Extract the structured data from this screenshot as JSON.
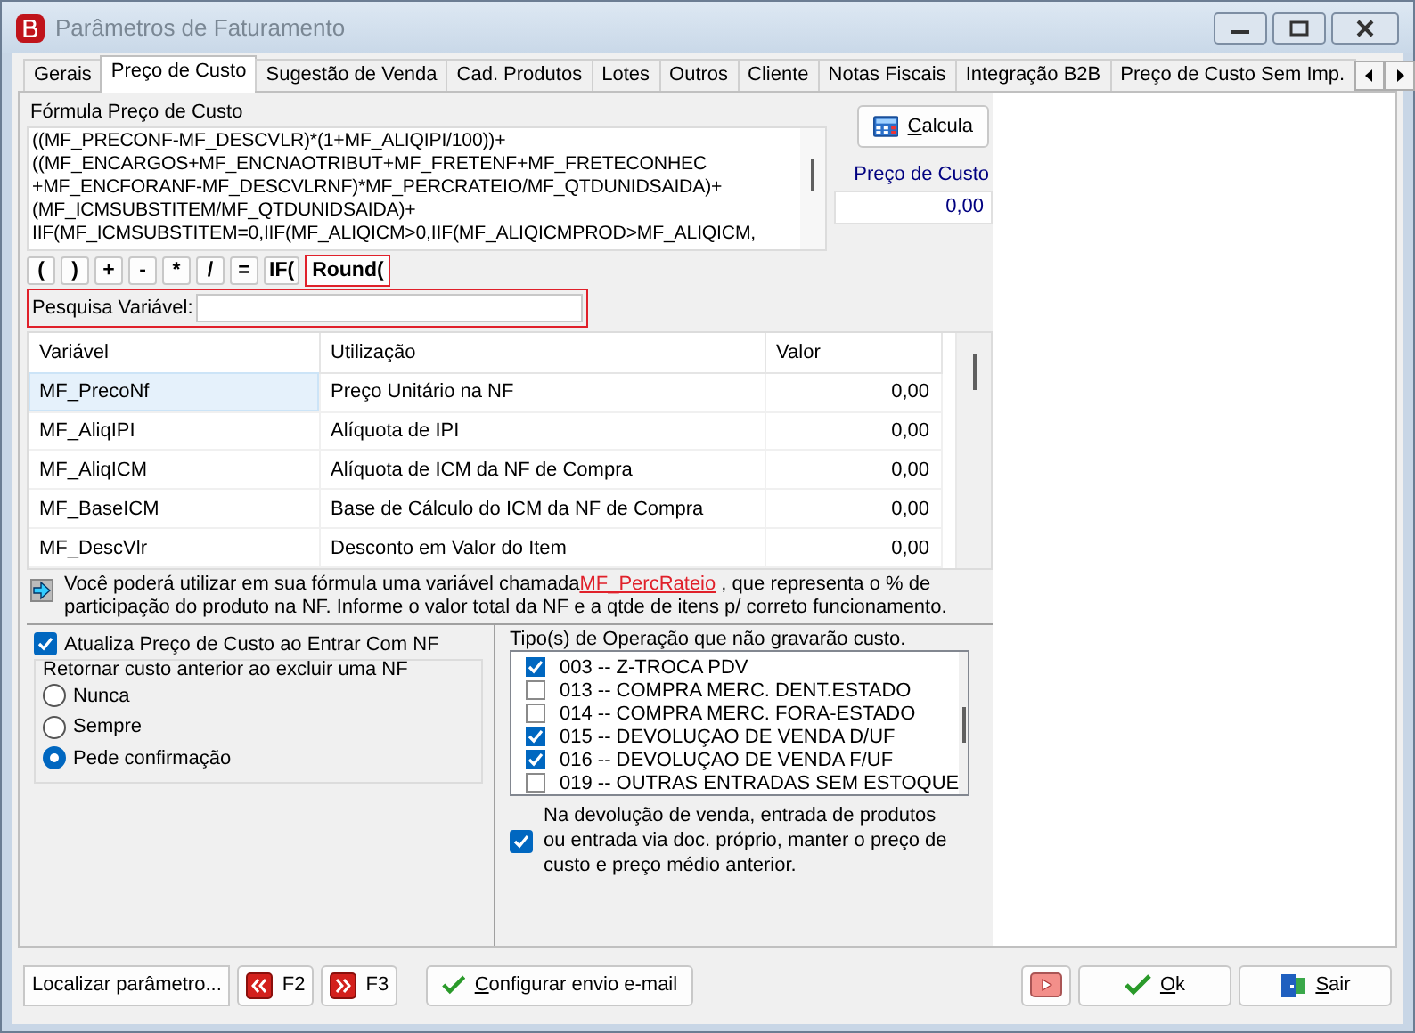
{
  "window": {
    "title": "Parâmetros de Faturamento"
  },
  "tabs": [
    {
      "label": "Gerais",
      "selected": false
    },
    {
      "label": "Preço de Custo",
      "selected": true
    },
    {
      "label": "Sugestão de  Venda",
      "selected": false
    },
    {
      "label": "Cad. Produtos",
      "selected": false
    },
    {
      "label": "Lotes",
      "selected": false
    },
    {
      "label": "Outros",
      "selected": false
    },
    {
      "label": "Cliente",
      "selected": false
    },
    {
      "label": "Notas Fiscais",
      "selected": false
    },
    {
      "label": "Integração B2B",
      "selected": false
    },
    {
      "label": "Preço de Custo Sem Imp.",
      "selected": false
    }
  ],
  "formula": {
    "label": "Fórmula Preço de Custo",
    "lines": [
      "((MF_PRECONF-MF_DESCVLR)*(1+MF_ALIQIPI/100))+",
      "((MF_ENCARGOS+MF_ENCNAOTRIBUT+MF_FRETENF+MF_FRETECONHEC",
      "+MF_ENCFORANF-MF_DESCVLRNF)*MF_PERCRATEIO/MF_QTDUNIDSAIDA)+",
      "(MF_ICMSUBSTITEM/MF_QTDUNIDSAIDA)+",
      "IIF(MF_ICMSUBSTITEM=0,IIF(MF_ALIQICM>0,IIF(MF_ALIQICMPROD>MF_ALIQICM,"
    ]
  },
  "calc_button": "Calcula",
  "cost": {
    "label": "Preço de Custo",
    "value": "0,00"
  },
  "operators": [
    {
      "label": "(",
      "highlighted": false
    },
    {
      "label": ")",
      "highlighted": false
    },
    {
      "label": "+",
      "highlighted": false
    },
    {
      "label": "-",
      "highlighted": false
    },
    {
      "label": "*",
      "highlighted": false
    },
    {
      "label": "/",
      "highlighted": false
    },
    {
      "label": "=",
      "highlighted": false
    },
    {
      "label": "IF(",
      "highlighted": false
    },
    {
      "label": "Round(",
      "highlighted": true
    }
  ],
  "search": {
    "label": "Pesquisa Variável:",
    "highlighted": true
  },
  "table": {
    "columns": [
      "Variável",
      "Utilização",
      "Valor"
    ],
    "rows": [
      {
        "cells": [
          "MF_PrecoNf",
          "Preço Unitário na NF",
          "0,00"
        ],
        "selected": true
      },
      {
        "cells": [
          "MF_AliqIPI",
          "Alíquota de IPI",
          "0,00"
        ],
        "selected": false
      },
      {
        "cells": [
          "MF_AliqICM",
          "Alíquota de ICM da NF de Compra",
          "0,00"
        ],
        "selected": false
      },
      {
        "cells": [
          "MF_BaseICM",
          "Base de Cálculo do ICM da NF de Compra",
          "0,00"
        ],
        "selected": false
      },
      {
        "cells": [
          "MF_DescVlr",
          "Desconto em Valor do Item",
          "0,00"
        ],
        "selected": false
      }
    ]
  },
  "note": {
    "before": "Você poderá utilizar em sua fórmula uma variável chamada",
    "link": "MF_PercRateio",
    "after": " , que representa o % de participação do produto na NF. Informe o valor total da NF e a qtde de itens p/ correto funcionamento."
  },
  "update_cost": {
    "label": "Atualiza Preço de Custo ao Entrar Com NF",
    "checked": true
  },
  "return_cost": {
    "label": "Retornar custo anterior ao excluir uma NF",
    "options": [
      {
        "label": "Nunca",
        "selected": false
      },
      {
        "label": "Sempre",
        "selected": false
      },
      {
        "label": "Pede confirmação",
        "selected": true
      }
    ]
  },
  "operations": {
    "label": "Tipo(s) de Operação que não gravarão custo.",
    "items": [
      {
        "label": "003 -- Z-TROCA PDV",
        "checked": true
      },
      {
        "label": "013 -- COMPRA MERC. DENT.ESTADO",
        "checked": false
      },
      {
        "label": "014 -- COMPRA MERC. FORA-ESTADO",
        "checked": false
      },
      {
        "label": "015 -- DEVOLUÇAO DE VENDA D/UF",
        "checked": true
      },
      {
        "label": "016 -- DEVOLUÇAO DE VENDA F/UF",
        "checked": true
      },
      {
        "label": "019 -- OUTRAS ENTRADAS  SEM ESTOQUE",
        "checked": false
      }
    ]
  },
  "keep_cost": {
    "label": "Na devolução de venda, entrada de produtos ou entrada via doc. próprio, manter o preço de custo e preço médio anterior.",
    "checked": true
  },
  "footer": {
    "find": "Localizar parâmetro...",
    "prev": "F2",
    "next": "F3",
    "email": "Configurar envio e-mail",
    "ok": "Ok",
    "exit": "Sair"
  }
}
